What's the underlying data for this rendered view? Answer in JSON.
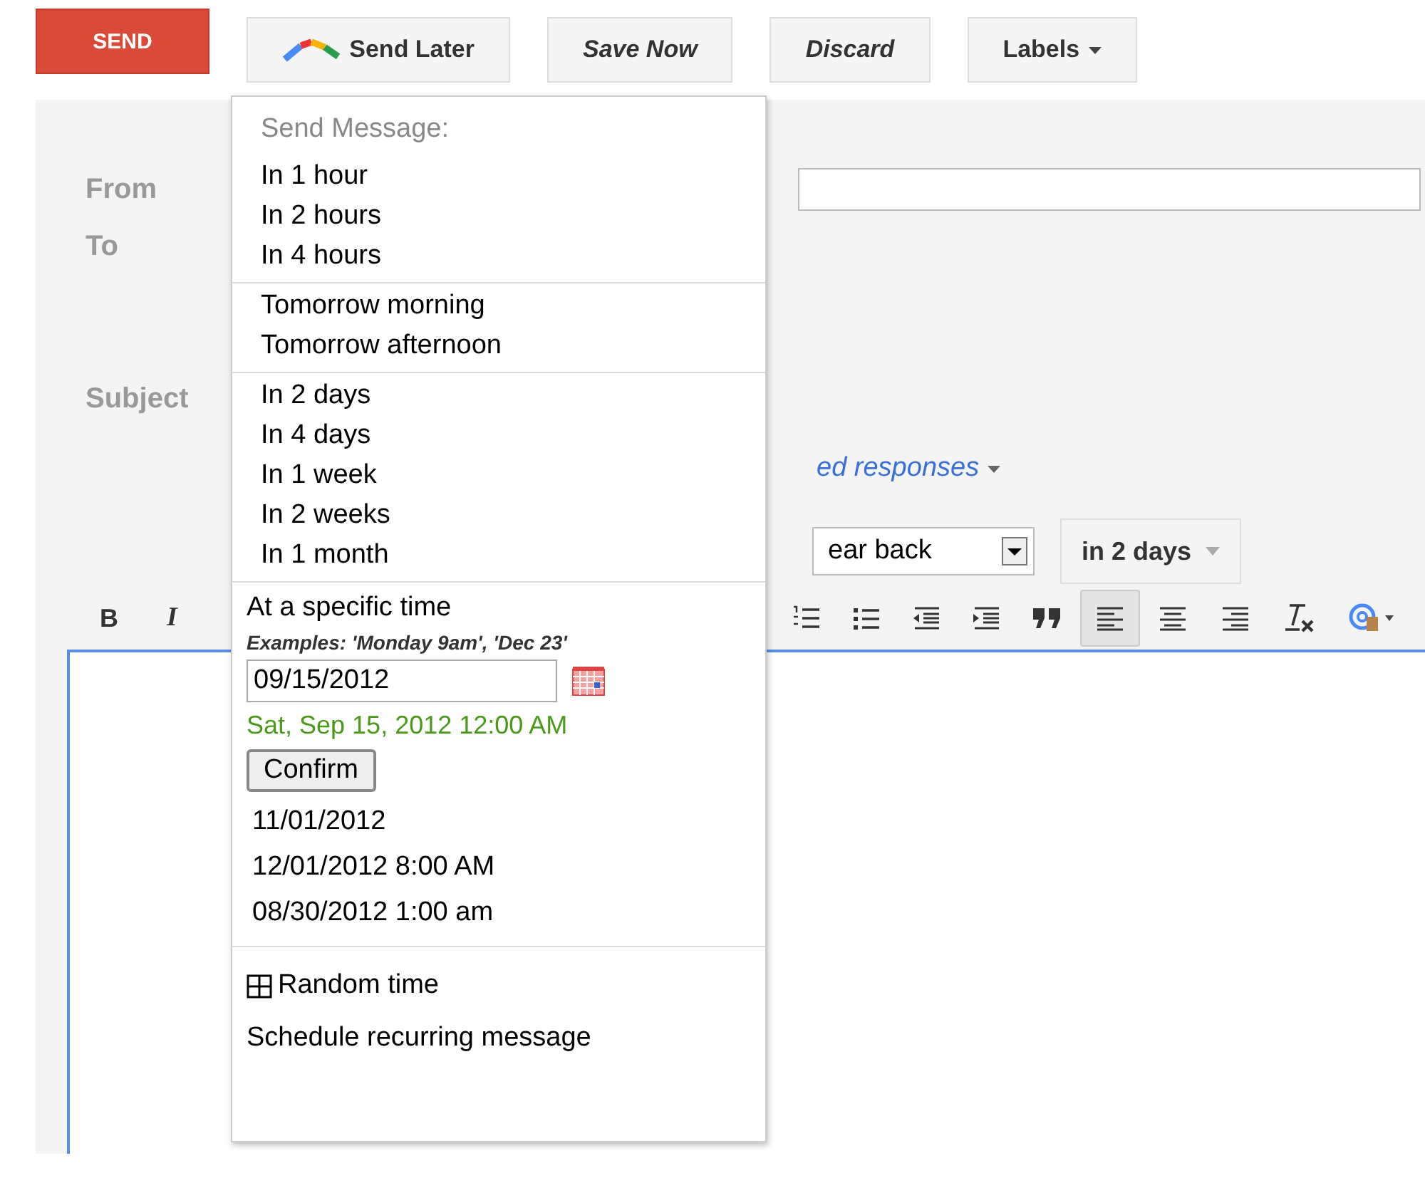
{
  "toolbar": {
    "send": "SEND",
    "send_later": "Send Later",
    "save_now": "Save Now",
    "discard": "Discard",
    "labels": "Labels"
  },
  "form": {
    "labels": [
      "From",
      "To",
      "Subject"
    ],
    "canned_responses": "ed responses",
    "select_value": "ear back",
    "in_days_button": "in 2 days",
    "bold": "B",
    "italic": "I",
    "alignment_buttons": [
      {
        "selected": true
      },
      {
        "selected": false
      },
      {
        "selected": false
      }
    ]
  },
  "send_later_menu": {
    "heading": "Send Message:",
    "groups": [
      [
        "In 1 hour",
        "In 2 hours",
        "In 4 hours"
      ],
      [
        "Tomorrow morning",
        "Tomorrow afternoon"
      ],
      [
        "In 2 days",
        "In 4 days",
        "In 1 week",
        "In 2 weeks",
        "In 1 month"
      ]
    ],
    "specific_time": {
      "label": "At a specific time",
      "examples": "Examples: 'Monday 9am', 'Dec 23'",
      "value": "09/15/2012",
      "parsed": "Sat, Sep 15, 2012 12:00 AM",
      "confirm": "Confirm"
    },
    "recent": [
      "11/01/2012",
      "12/01/2012 8:00 AM",
      "08/30/2012 1:00 am"
    ],
    "random_time": "Random time",
    "recurring": "Schedule recurring message"
  }
}
